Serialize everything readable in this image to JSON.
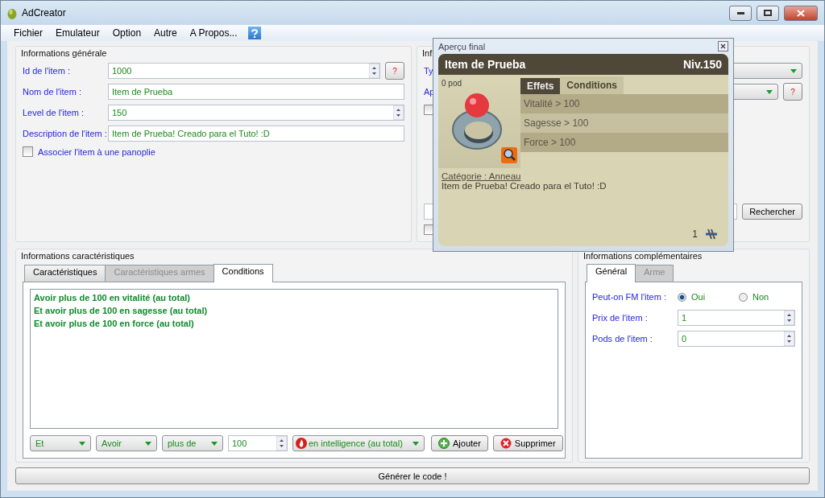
{
  "window": {
    "title": "AdCreator"
  },
  "menu": [
    {
      "label": "Fichier"
    },
    {
      "label": "Emulateur"
    },
    {
      "label": "Option"
    },
    {
      "label": "Autre"
    },
    {
      "label": "A Propos..."
    }
  ],
  "general": {
    "title": "Informations générale",
    "fields": [
      {
        "label": "Id de l'item :",
        "value": "1000",
        "kind": "spin",
        "help": "?"
      },
      {
        "label": "Nom de l'item :",
        "value": "Item de Prueba",
        "kind": "text"
      },
      {
        "label": "Level de l'item :",
        "value": "150",
        "kind": "spin"
      },
      {
        "label": "Description de l'item :",
        "value": "Item de Prueba! Creado para el Tuto! :D",
        "kind": "text"
      }
    ],
    "checkbox": {
      "label": "Associer l'item à une panoplie",
      "checked": false
    }
  },
  "info2": {
    "title": "Inf",
    "rows": [
      {
        "label": "Ty",
        "help": ""
      },
      {
        "label": "Ap",
        "help": "?"
      }
    ],
    "checkbox_top": {
      "checked": false
    },
    "search_button": "Rechercher",
    "checkbox_bottom": {
      "checked": false
    }
  },
  "caracteristiques": {
    "title": "Informations caractéristiques",
    "tabs": [
      {
        "label": "Caractéristiques",
        "selected": false,
        "disabled": false
      },
      {
        "label": "Caractéristiques armes",
        "selected": false,
        "disabled": true
      },
      {
        "label": "Conditions",
        "selected": true,
        "disabled": false
      }
    ],
    "conditions": [
      "Avoir plus de 100 en vitalité (au total)",
      "Et avoir plus de 100 en sagesse (au total)",
      "Et avoir plus de 100 en force (au total)"
    ],
    "combos": [
      "Et",
      "Avoir",
      "plus de"
    ],
    "amount": "100",
    "stat": "en intelligence (au total)",
    "add_button": "Ajouter",
    "remove_button": "Supprimer"
  },
  "complementaires": {
    "title": "Informations complémentaires",
    "tabs": [
      {
        "label": "Général",
        "selected": true,
        "disabled": false
      },
      {
        "label": "Arme",
        "selected": false,
        "disabled": true
      }
    ],
    "fm": {
      "label": "Peut-on FM l'item :",
      "options": [
        {
          "label": "Oui",
          "selected": true
        },
        {
          "label": "Non",
          "selected": false
        }
      ]
    },
    "fields": [
      {
        "label": "Prix de l'item :",
        "value": "1"
      },
      {
        "label": "Pods de l'item :",
        "value": "0"
      }
    ]
  },
  "generate_button": "Générer le code !",
  "preview": {
    "title": "Aperçu final",
    "item_name": "Item de Prueba",
    "level": "Niv.150",
    "weight": "0 pod",
    "tabs": [
      {
        "label": "Effets",
        "selected": false
      },
      {
        "label": "Conditions",
        "selected": true
      }
    ],
    "conditions": [
      "Vitalité > 100",
      "Sagesse > 100",
      "Force > 100"
    ],
    "category": "Catégorie : Anneau",
    "description": "Item de Prueba! Creado para el Tuto! :D",
    "quantity": "1"
  }
}
